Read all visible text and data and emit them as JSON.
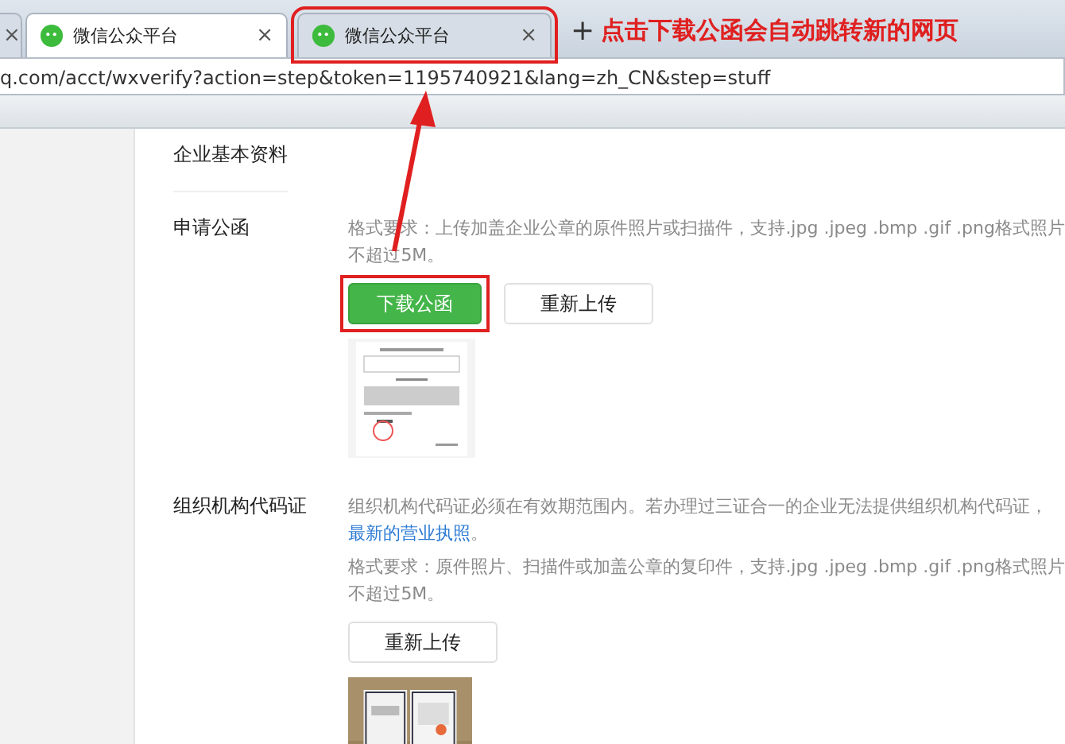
{
  "browser": {
    "tabs": [
      {
        "kind": "partial",
        "close": "×",
        "selected": false,
        "annotated": false
      },
      {
        "kind": "full",
        "title": "微信公众平台",
        "close": "×",
        "selected": true,
        "annotated": false
      },
      {
        "kind": "full",
        "title": "微信公众平台",
        "close": "×",
        "selected": false,
        "annotated": true
      }
    ],
    "new_tab": "+",
    "address": "q.com/acct/wxverify?action=step&token=1195740921&lang=zh_CN&step=stuff"
  },
  "annotation": {
    "text": "点击下载公函会自动跳转新的网页"
  },
  "section_title": "企业基本资料",
  "fields": [
    {
      "label": "申请公函",
      "notes": [
        {
          "lines": [
            "格式要求：上传加盖企业公章的原件照片或扫描件，支持.jpg .jpeg .bmp .gif .png格式照片",
            "不超过5M。"
          ]
        }
      ],
      "buttons": [
        {
          "label": "下载公函",
          "kind": "primary",
          "annotated": true
        },
        {
          "label": "重新上传",
          "kind": "default",
          "annotated": false
        }
      ],
      "image": {
        "kind": "document"
      }
    },
    {
      "label": "组织机构代码证",
      "notes": [
        {
          "lines": [
            "组织机构代码证必须在有效期范围内。若办理过三证合一的企业无法提供组织机构代码证，"
          ],
          "link": "最新的营业执照",
          "after": "。"
        },
        {
          "lines": [
            "格式要求：原件照片、扫描件或加盖公章的复印件，支持.jpg .jpeg .bmp .gif .png格式照片",
            "不超过5M。"
          ]
        }
      ],
      "buttons": [
        {
          "label": "重新上传",
          "kind": "default",
          "annotated": false
        }
      ],
      "image": {
        "kind": "picture"
      }
    }
  ]
}
